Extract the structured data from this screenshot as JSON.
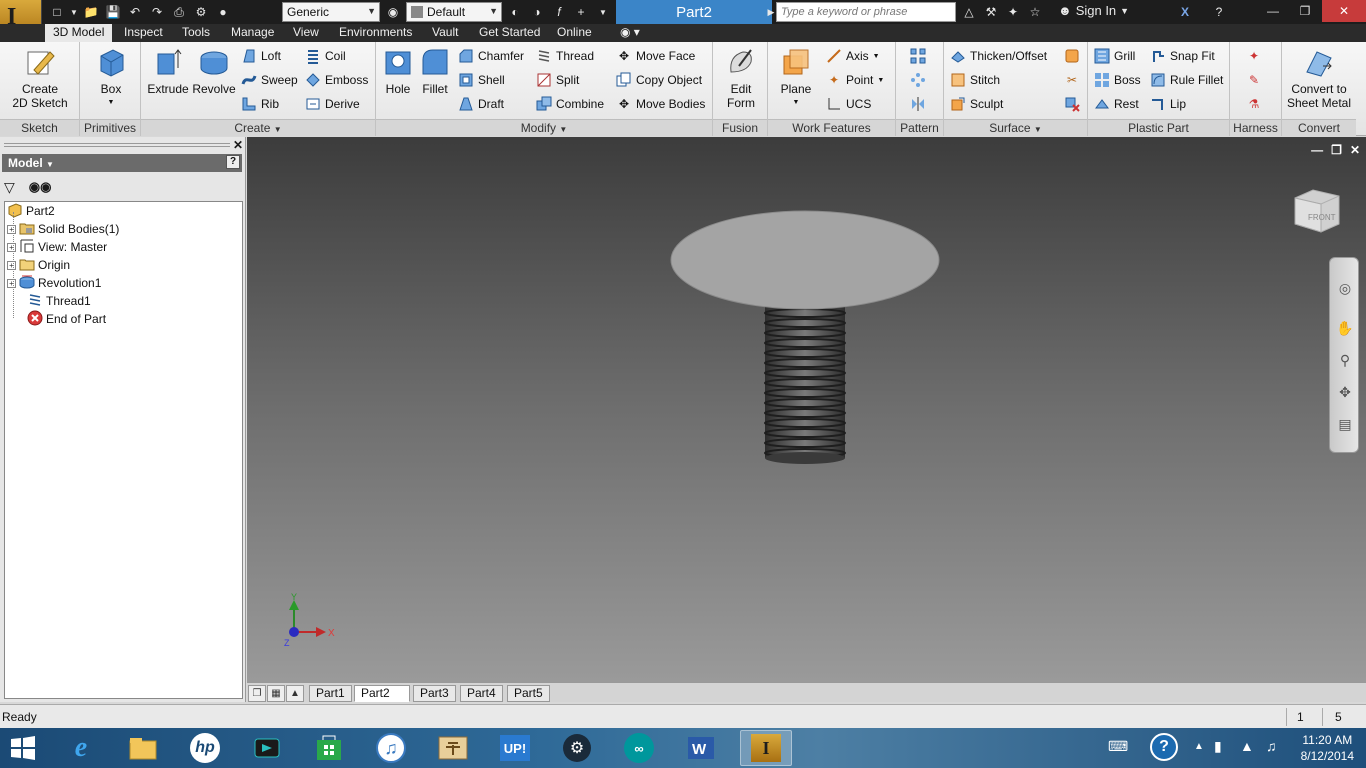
{
  "window": {
    "document_title": "Part2"
  },
  "qat": {
    "material": "Generic",
    "appearance": "Default",
    "search_placeholder": "Type a keyword or phrase",
    "sign_in": "Sign In"
  },
  "tabs": [
    "3D Model",
    "Inspect",
    "Tools",
    "Manage",
    "View",
    "Environments",
    "Vault",
    "Get Started",
    "Online"
  ],
  "ribbon": {
    "sketch": {
      "label": "Sketch",
      "create_2d_sketch": "Create\n2D Sketch"
    },
    "primitives": {
      "label": "Primitives",
      "box": "Box"
    },
    "create": {
      "label": "Create",
      "extrude": "Extrude",
      "revolve": "Revolve",
      "loft": "Loft",
      "sweep": "Sweep",
      "rib": "Rib",
      "coil": "Coil",
      "emboss": "Emboss",
      "derive": "Derive"
    },
    "modify": {
      "label": "Modify",
      "hole": "Hole",
      "fillet": "Fillet",
      "chamfer": "Chamfer",
      "shell": "Shell",
      "draft": "Draft",
      "thread": "Thread",
      "split": "Split",
      "combine": "Combine",
      "move_face": "Move Face",
      "copy_object": "Copy Object",
      "move_bodies": "Move Bodies"
    },
    "fusion": {
      "label": "Fusion",
      "edit_form": "Edit\nForm"
    },
    "work_features": {
      "label": "Work Features",
      "plane": "Plane",
      "axis": "Axis",
      "point": "Point",
      "ucs": "UCS"
    },
    "pattern": {
      "label": "Pattern"
    },
    "surface": {
      "label": "Surface",
      "thicken_offset": "Thicken/Offset",
      "stitch": "Stitch",
      "sculpt": "Sculpt"
    },
    "plastic_part": {
      "label": "Plastic Part",
      "grill": "Grill",
      "boss": "Boss",
      "rest": "Rest",
      "snap_fit": "Snap Fit",
      "rule_fillet": "Rule Fillet",
      "lip": "Lip"
    },
    "harness": {
      "label": "Harness"
    },
    "convert": {
      "label": "Convert",
      "convert_to_sheet_metal": "Convert to\nSheet Metal"
    }
  },
  "browser": {
    "title": "Model",
    "tree": [
      "Part2",
      "Solid Bodies(1)",
      "View: Master",
      "Origin",
      "Revolution1",
      "Thread1",
      "End of Part"
    ]
  },
  "viewcube": {
    "face": "FRONT"
  },
  "triad": {
    "x": "X",
    "y": "Y",
    "z": "Z"
  },
  "doc_tabs": [
    "Part1",
    "Part2",
    "Part3",
    "Part4",
    "Part5"
  ],
  "status": {
    "text": "Ready",
    "count_a": "1",
    "count_b": "5"
  },
  "taskbar": {
    "time": "11:20 AM",
    "date": "8/12/2014",
    "up_label": "UP!"
  }
}
